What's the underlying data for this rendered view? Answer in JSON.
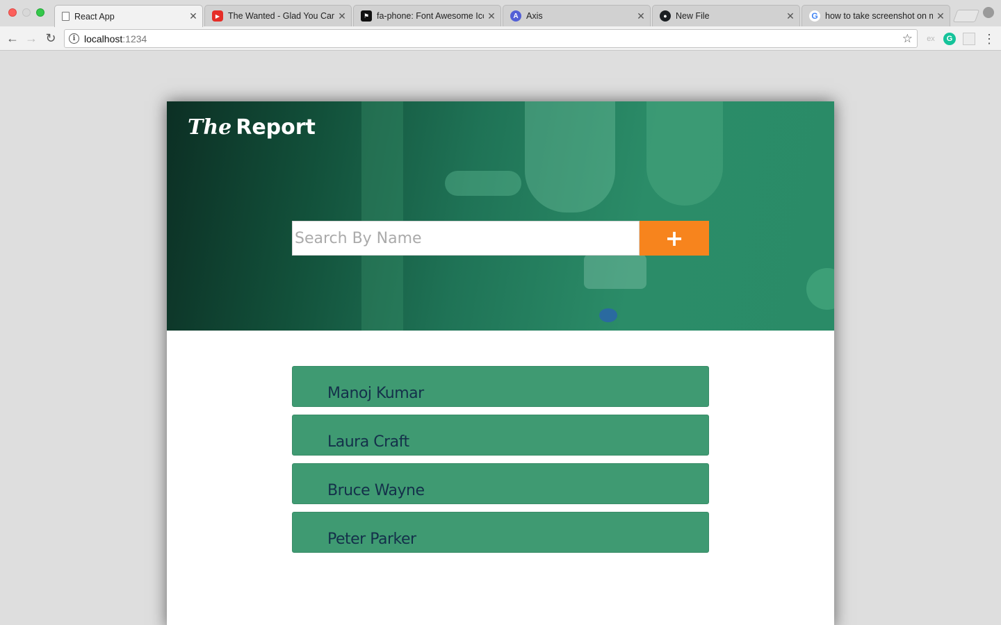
{
  "browser": {
    "tabs": [
      {
        "title": "React App",
        "icon": "page-icon",
        "active": true
      },
      {
        "title": "The Wanted - Glad You Cam",
        "icon": "youtube-icon",
        "active": false
      },
      {
        "title": "fa-phone: Font Awesome Ico",
        "icon": "font-awesome-icon",
        "active": false
      },
      {
        "title": "Axis",
        "icon": "axis-icon",
        "active": false
      },
      {
        "title": "New File",
        "icon": "github-icon",
        "active": false
      },
      {
        "title": "how to take screenshot on m",
        "icon": "google-icon",
        "active": false
      }
    ],
    "url_host": "localhost",
    "url_port": ":1234",
    "extensions": {
      "ex_label": "ex",
      "grammarly_label": "G"
    }
  },
  "app": {
    "brand_the": "The",
    "brand_report": "Report",
    "search_placeholder": "Search By Name",
    "add_button_label": "+",
    "accent_color": "#f7841d",
    "item_color": "#3f9a72",
    "items": [
      "Manoj Kumar",
      "Laura Craft",
      "Bruce Wayne",
      "Peter Parker"
    ]
  }
}
